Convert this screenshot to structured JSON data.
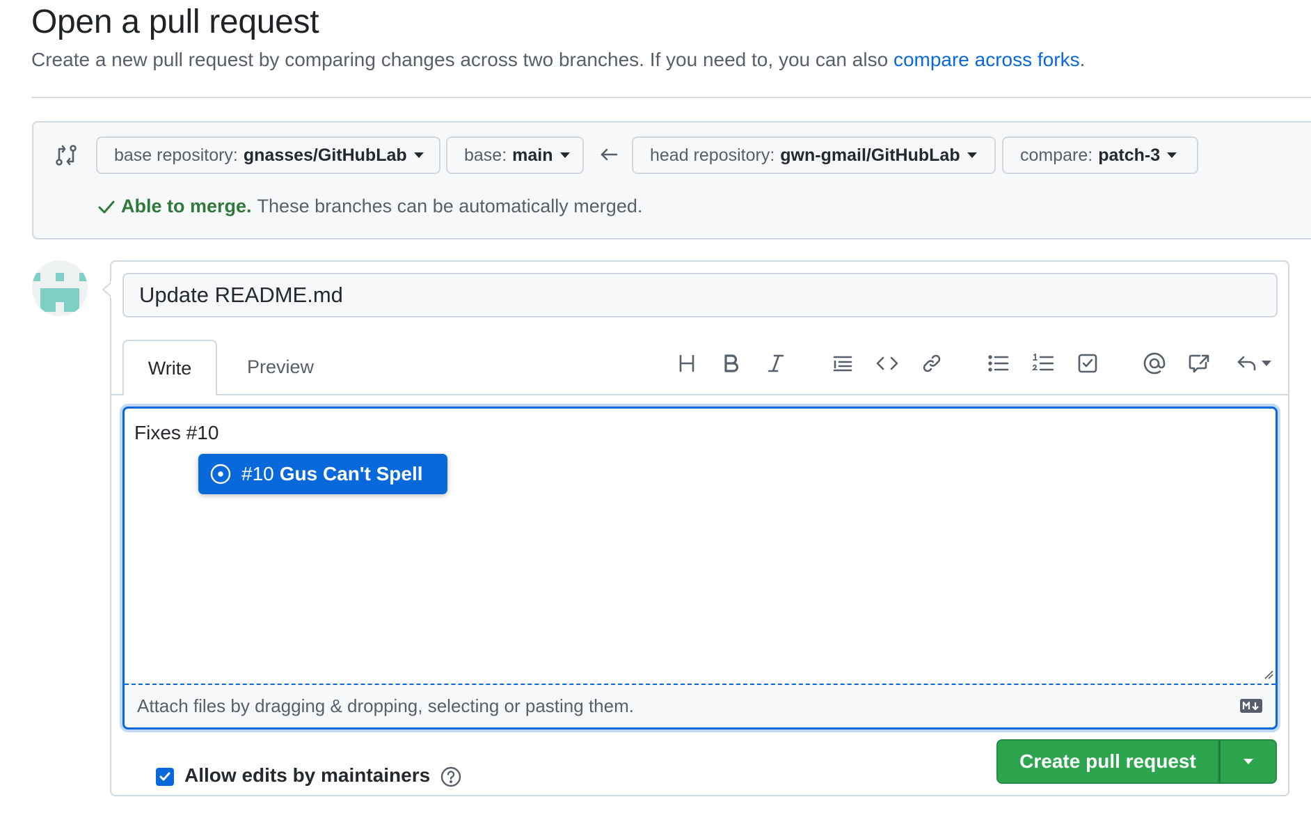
{
  "header": {
    "title": "Open a pull request",
    "subtitle_prefix": "Create a new pull request by comparing changes across two branches. If you need to, you can also ",
    "subtitle_link": "compare across forks",
    "subtitle_suffix": "."
  },
  "compare": {
    "base_repo_label": "base repository:",
    "base_repo_value": "gnasses/GitHubLab",
    "base_label": "base:",
    "base_value": "main",
    "head_repo_label": "head repository:",
    "head_repo_value": "gwn-gmail/GitHubLab",
    "compare_label": "compare:",
    "compare_value": "patch-3",
    "merge_ok": "Able to merge.",
    "merge_text": "These branches can be automatically merged."
  },
  "form": {
    "title_value": "Update README.md",
    "tabs": [
      "Write",
      "Preview"
    ],
    "toolbar": [
      "heading-icon",
      "bold-icon",
      "italic-icon",
      "quote-icon",
      "code-icon",
      "link-icon",
      "unordered-list-icon",
      "ordered-list-icon",
      "task-list-icon",
      "mention-icon",
      "cross-reference-icon",
      "reply-icon"
    ],
    "body_text": "Fixes #10",
    "suggestion": {
      "number": "#10",
      "title": "Gus Can't Spell"
    },
    "attach_text": "Attach files by dragging & dropping, selecting or pasting them.",
    "allow_edits_label": "Allow edits by maintainers",
    "allow_edits_checked": true,
    "create_button": "Create pull request"
  },
  "colors": {
    "accent": "#0969da",
    "success": "#2da44e",
    "merge_ok": "#2f7a3b"
  }
}
